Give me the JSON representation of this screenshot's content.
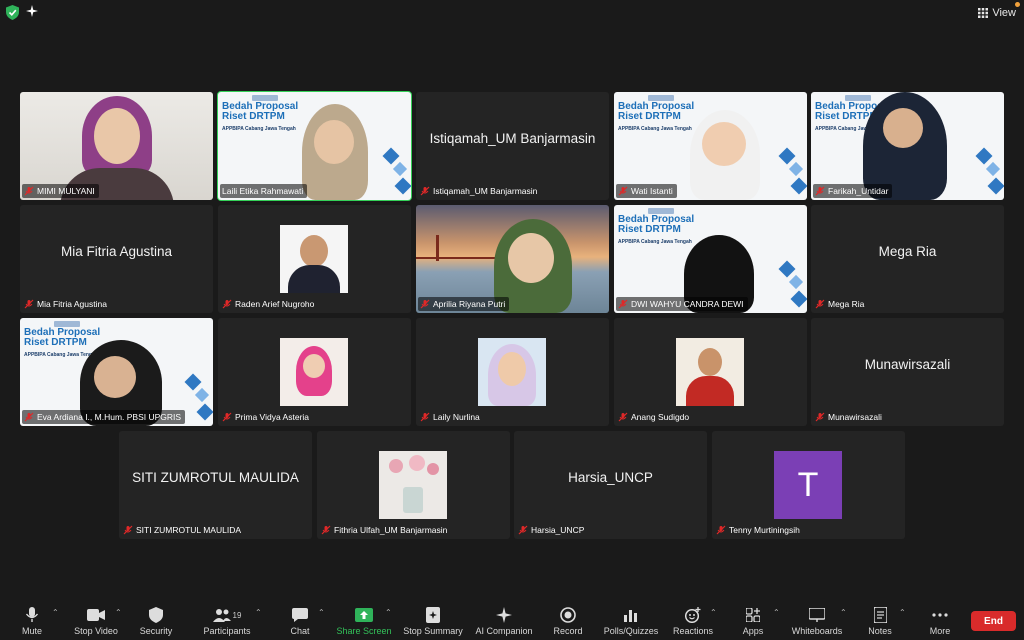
{
  "topbar": {
    "view_label": "View",
    "security_icon": "shield-check-icon",
    "ai_icon": "sparkle-icon"
  },
  "participants": [
    {
      "name": "MIMI MULYANI",
      "video": true,
      "muted": true
    },
    {
      "name": "Laili Etika Rahmawati",
      "video": true,
      "muted": false,
      "active_speaker": true
    },
    {
      "name": "Istiqamah_UM Banjarmasin",
      "video": false,
      "muted": true
    },
    {
      "name": "Wati Istanti",
      "video": true,
      "muted": true
    },
    {
      "name": "Farikah_Untidar",
      "video": true,
      "muted": true
    },
    {
      "name": "Mia Fitria Agustina",
      "video": false,
      "muted": true
    },
    {
      "name": "Raden Arief Nugroho",
      "video": false,
      "muted": true
    },
    {
      "name": "Aprilia Riyana Putri",
      "video": true,
      "muted": true
    },
    {
      "name": "DWI WAHYU CANDRA DEWI",
      "video": true,
      "muted": true
    },
    {
      "name": "Mega Ria",
      "video": false,
      "muted": true
    },
    {
      "name": "Eva Ardiana I., M.Hum. PBSI UPGRIS",
      "video": true,
      "muted": true
    },
    {
      "name": "Prima Vidya Asteria",
      "video": false,
      "muted": true
    },
    {
      "name": "Laily Nurlina",
      "video": false,
      "muted": true
    },
    {
      "name": "Anang Sudigdo",
      "video": false,
      "muted": true
    },
    {
      "name": "Munawirsazali",
      "video": false,
      "muted": true
    },
    {
      "name": "SITI ZUMROTUL MAULIDA",
      "video": false,
      "muted": true
    },
    {
      "name": "Fithria Ulfah_UM Banjarmasin",
      "video": false,
      "muted": true
    },
    {
      "name": "Harsia_UNCP",
      "video": false,
      "muted": true
    },
    {
      "name": "Tenny Murtiningsih",
      "video": false,
      "muted": true
    }
  ],
  "banner": {
    "title_line1": "Bedah Proposal",
    "title_line2": "Riset DRTPM",
    "subtitle": "APPBIPA Cabang Jawa Tengah"
  },
  "avatar_initial": "T",
  "avatar_color": "#7b3fb5",
  "accent_green": "#34d058",
  "end_color": "#d92b2b",
  "toolbar": {
    "mute": "Mute",
    "stop_video": "Stop Video",
    "security": "Security",
    "participants": "Participants",
    "participants_count": "19",
    "chat": "Chat",
    "share_screen": "Share Screen",
    "stop_summary": "Stop Summary",
    "ai_companion": "AI Companion",
    "record": "Record",
    "polls": "Polls/Quizzes",
    "reactions": "Reactions",
    "apps": "Apps",
    "whiteboards": "Whiteboards",
    "notes": "Notes",
    "more": "More",
    "end": "End"
  }
}
